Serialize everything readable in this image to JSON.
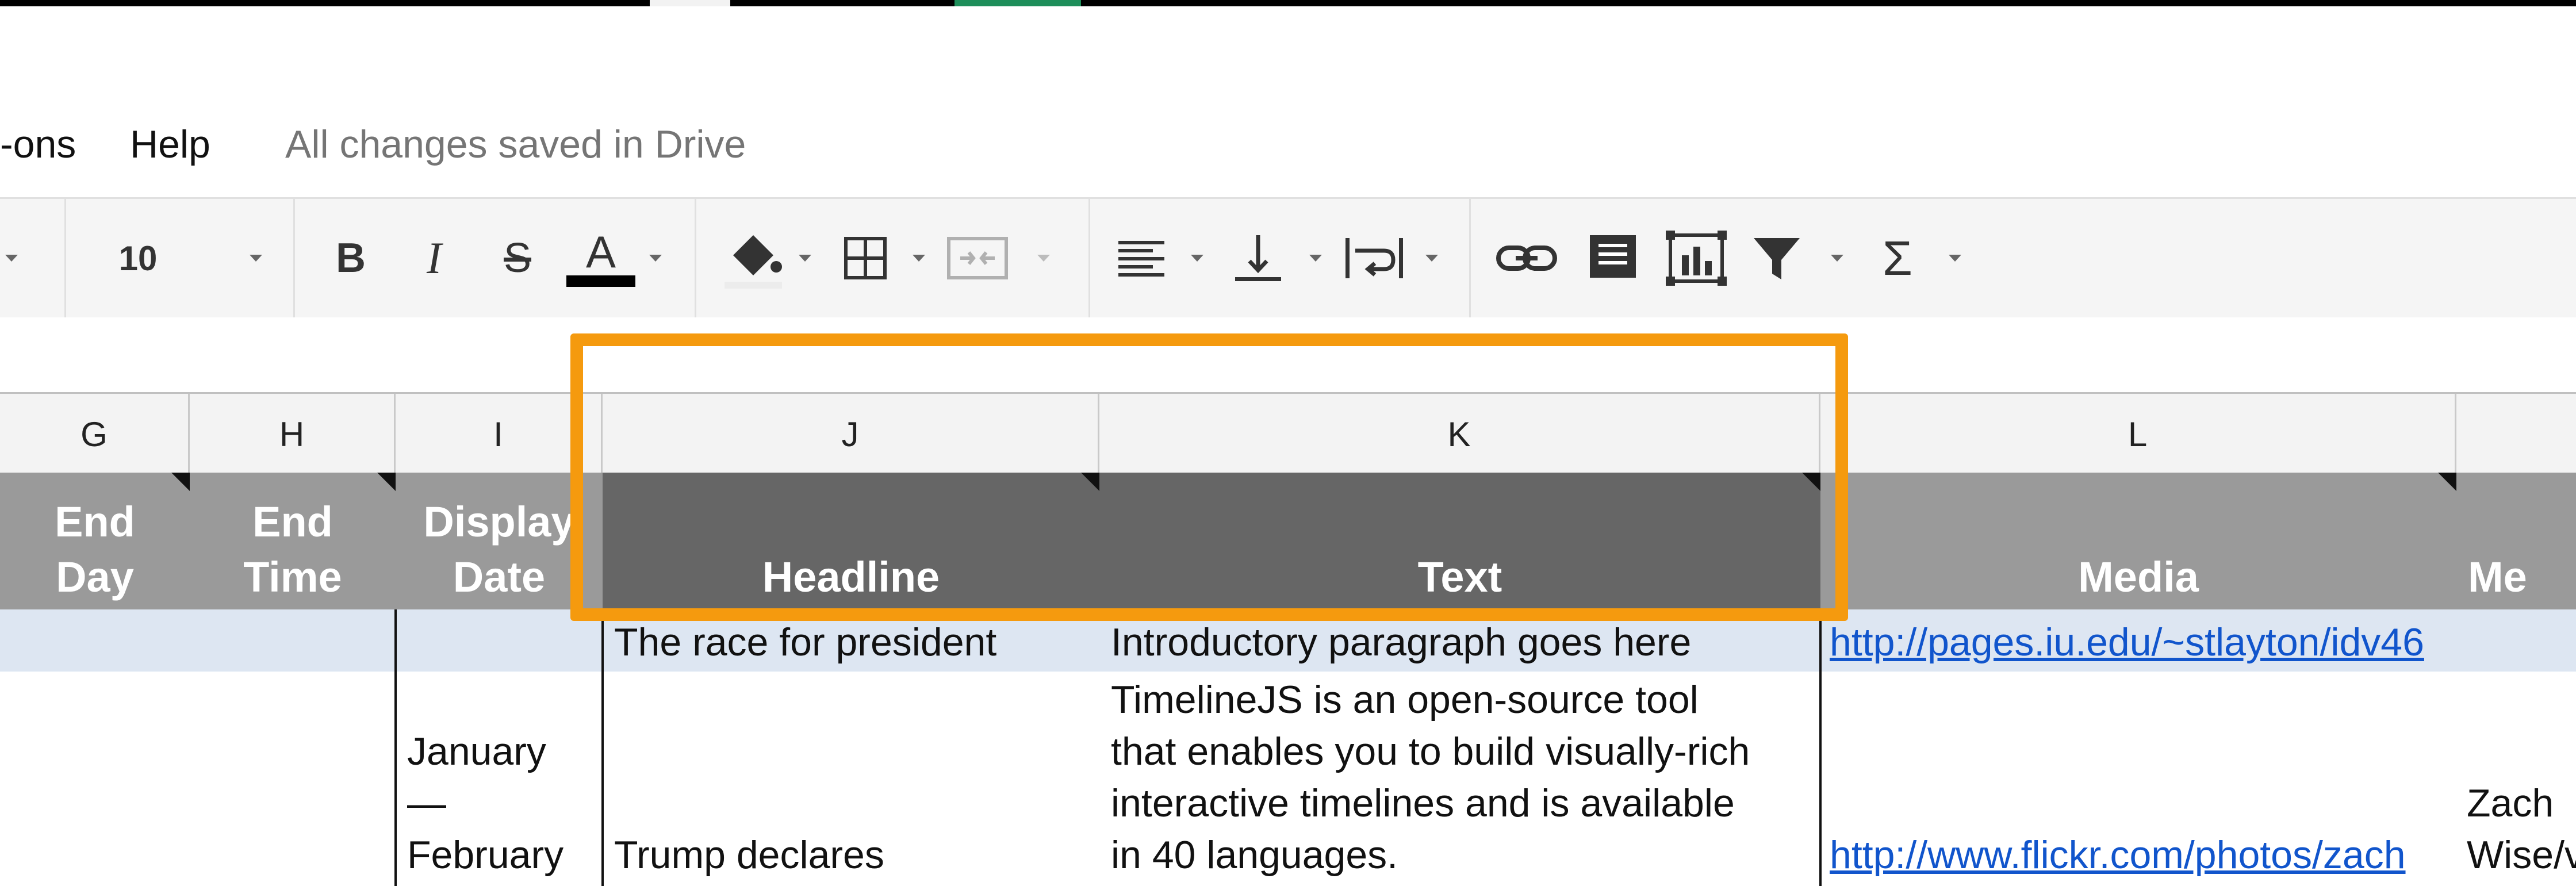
{
  "menu": {
    "addons_partial": "-ons",
    "help": "Help",
    "save_status": "All changes saved in Drive"
  },
  "toolbar": {
    "font_size": "10",
    "bold": "B",
    "italic": "I",
    "strike": "S",
    "text_color": "A",
    "sum": "Σ"
  },
  "columns": [
    "G",
    "H",
    "I",
    "J",
    "K",
    "L"
  ],
  "header_row": {
    "g_line1": "End",
    "g_line2": "Day",
    "h_line1": "End",
    "h_line2": "Time",
    "i_line1": "Display",
    "i_line2": "Date",
    "j": "Headline",
    "k": "Text",
    "l": "Media",
    "m_partial": "Me"
  },
  "rows": {
    "r1": {
      "headline": "The race for president",
      "text": "Introductory paragraph goes here",
      "media": "http://pages.iu.edu/~stlayton/idv46"
    },
    "r2": {
      "date_lines": [
        "January",
        "—",
        "February"
      ],
      "headline": "Trump declares",
      "text_lines": [
        "TimelineJS is an open-source tool",
        "that enables you to build visually-rich",
        "interactive timelines and is available",
        "in 40 languages."
      ],
      "media": "http://www.flickr.com/photos/zach",
      "credit_lines": [
        "Zach",
        "Wise/v"
      ]
    }
  },
  "colors": {
    "highlight": "#f59a0e",
    "header_dark": "#666666",
    "header_light": "#9a9a9a",
    "selected_row": "#dde6f2",
    "link": "#1155cc"
  }
}
